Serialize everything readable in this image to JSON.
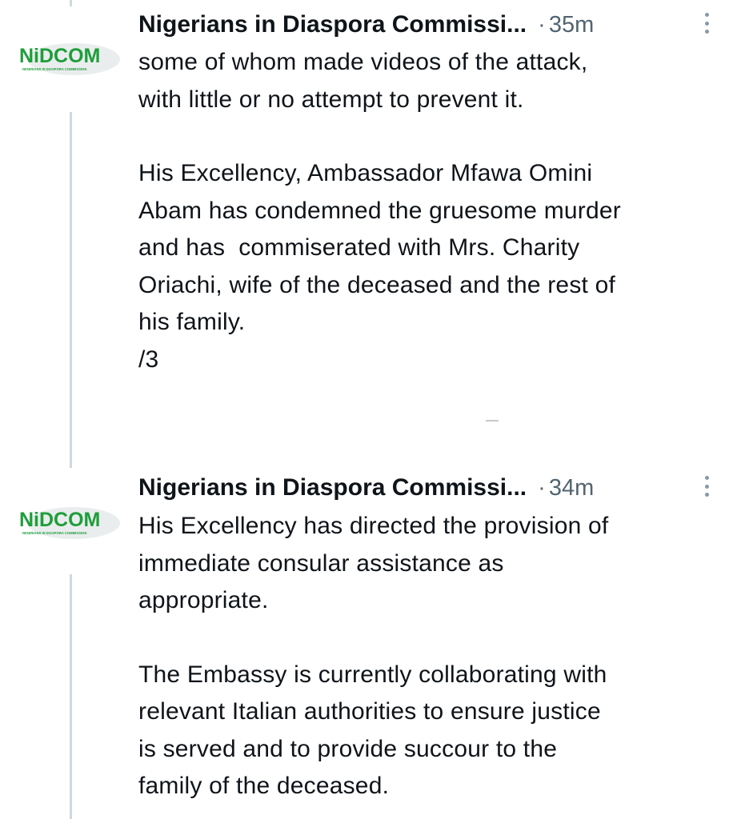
{
  "tweets": [
    {
      "avatar": {
        "logo_text": "NiDCOM",
        "logo_subtext": "NIGERIANS IN DIASPORA COMMISSION",
        "logo_color": "#1e9e3a"
      },
      "author_name": "Nigerians in Diaspora Commissi...",
      "separator": "·",
      "time": "35m",
      "paragraphs": [
        "some of whom made videos of the attack,\nwith little or no attempt to prevent it.",
        "His Excellency, Ambassador Mfawa Omini\nAbam has condemned the gruesome murder\nand has  commiserated with Mrs. Charity\nOriachi, wife of the deceased and the rest of\nhis family.\n/3"
      ]
    },
    {
      "avatar": {
        "logo_text": "NiDCOM",
        "logo_subtext": "NIGERIANS IN DIASPORA COMMISSION",
        "logo_color": "#1e9e3a"
      },
      "author_name": "Nigerians in Diaspora Commissi...",
      "separator": "·",
      "time": "34m",
      "paragraphs": [
        "His Excellency has directed the provision of\nimmediate consular assistance as\nappropriate.",
        "The Embassy is currently collaborating with\nrelevant Italian authorities to ensure justice\nis served and to provide succour to the\nfamily of the deceased."
      ]
    }
  ],
  "colors": {
    "text": "#0f1419",
    "secondary_text": "#536471",
    "thread_line": "#cfd9de",
    "background": "#ffffff"
  },
  "icons": [
    "more-options-icon"
  ]
}
